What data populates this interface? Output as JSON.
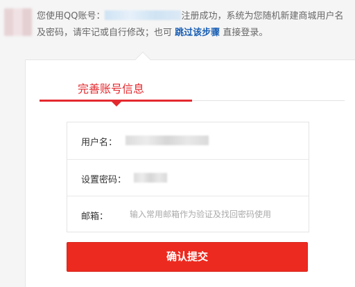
{
  "notice": {
    "text_before": "您使用QQ账号：",
    "text_after": "注册成功，系统为您随机新建商城用户名",
    "line2_text": "及密码，请牢记或自行修改；也可",
    "skip_link": "跳过该步骤",
    "line2_tail": "直接登录。",
    "link_color": "#1a5fb4"
  },
  "tab": {
    "title": "完善账号信息",
    "accent_color": "#e4292e"
  },
  "form": {
    "username_label": "用户名：",
    "password_label": "设置密码：",
    "email_label": "邮箱：",
    "email_placeholder": "输入常用邮箱作为验证及找回密码使用"
  },
  "submit": {
    "label": "确认提交",
    "color": "#ed2a1f"
  }
}
